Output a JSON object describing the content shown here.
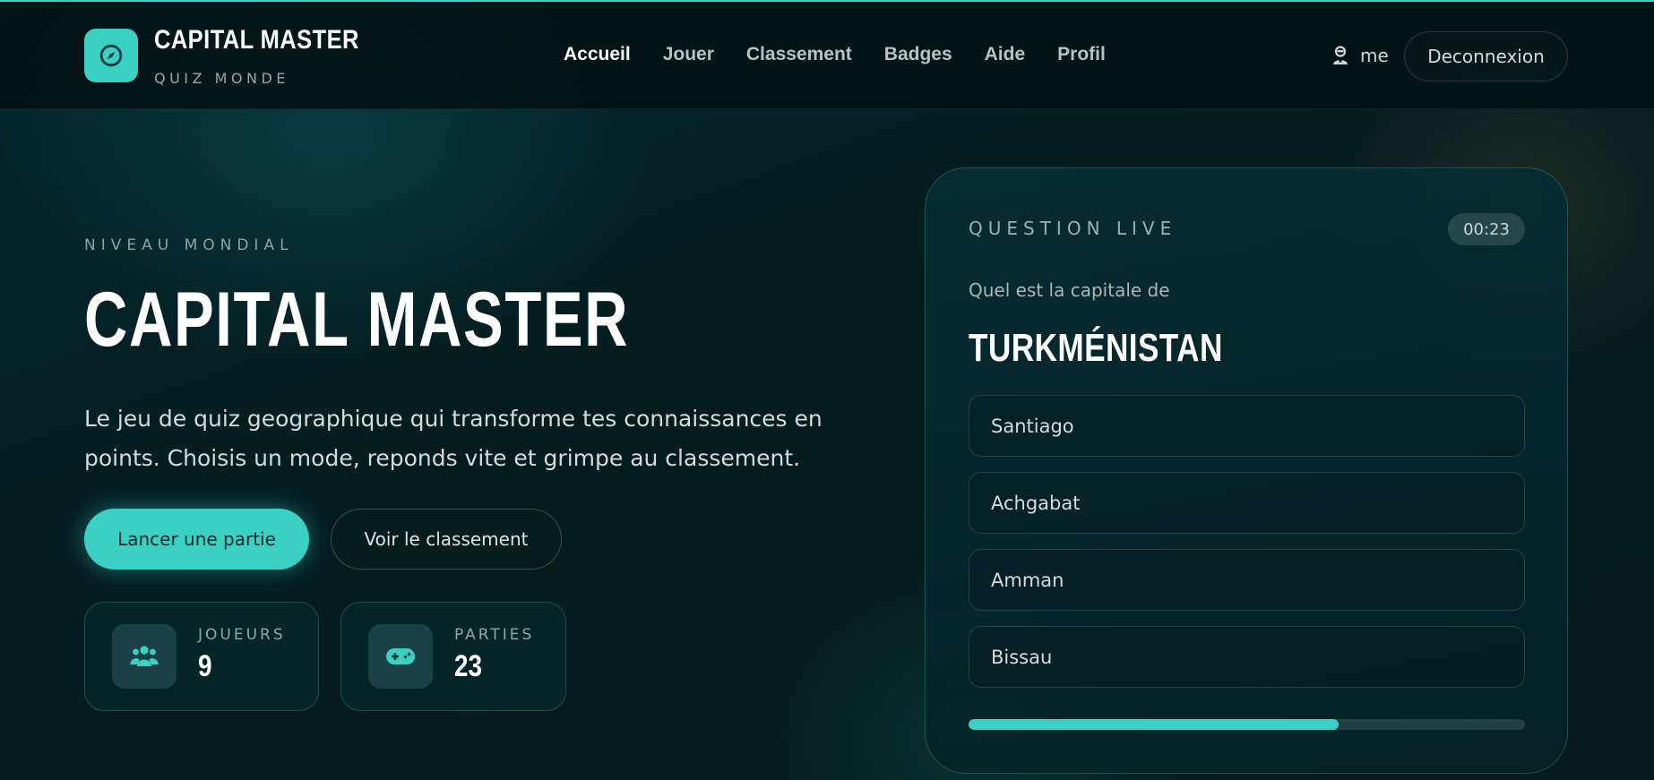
{
  "brand": {
    "title": "CAPITAL MASTER",
    "subtitle": "QUIZ MONDE"
  },
  "nav": {
    "items": [
      {
        "label": "Accueil",
        "active": true
      },
      {
        "label": "Jouer",
        "active": false
      },
      {
        "label": "Classement",
        "active": false
      },
      {
        "label": "Badges",
        "active": false
      },
      {
        "label": "Aide",
        "active": false
      },
      {
        "label": "Profil",
        "active": false
      }
    ]
  },
  "user": {
    "name": "me",
    "logout_label": "Deconnexion"
  },
  "hero": {
    "eyebrow": "NIVEAU MONDIAL",
    "title": "CAPITAL MASTER",
    "description": "Le jeu de quiz geographique qui transforme tes connaissances en points. Choisis un mode, reponds vite et grimpe au classement.",
    "primary_cta": "Lancer une partie",
    "secondary_cta": "Voir le classement"
  },
  "stats": [
    {
      "label": "JOUEURS",
      "value": "9",
      "icon": "users-icon"
    },
    {
      "label": "PARTIES",
      "value": "23",
      "icon": "gamepad-icon"
    }
  ],
  "quiz": {
    "eyebrow": "QUESTION LIVE",
    "timer": "00:23",
    "prompt": "Quel est la capitale de",
    "country": "TURKMÉNISTAN",
    "options": [
      "Santiago",
      "Achgabat",
      "Amman",
      "Bissau"
    ],
    "progress_percent": 66.5
  },
  "colors": {
    "accent": "#3ad0c4",
    "background": "#041c20",
    "topline": "#3fd1c5"
  }
}
